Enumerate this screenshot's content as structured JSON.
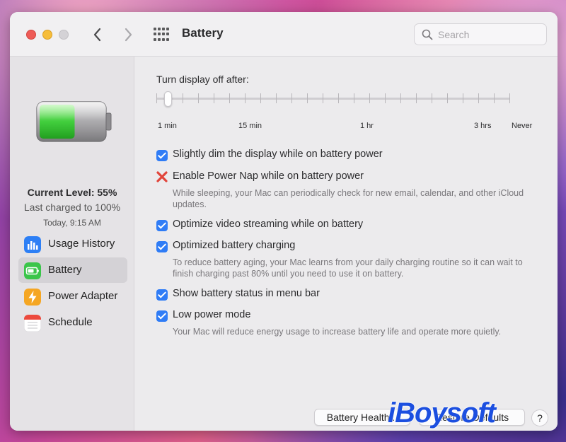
{
  "window": {
    "title": "Battery",
    "search_placeholder": "Search"
  },
  "sidebar": {
    "current_level": "Current Level: 55%",
    "battery_level": 0.55,
    "last_charged": "Last charged to 100%",
    "charged_time": "Today, 9:15 AM",
    "items": [
      {
        "label": "Usage History",
        "icon": "usage-history-icon",
        "active": false
      },
      {
        "label": "Battery",
        "icon": "battery-icon",
        "active": true
      },
      {
        "label": "Power Adapter",
        "icon": "power-adapter-icon",
        "active": false
      },
      {
        "label": "Schedule",
        "icon": "schedule-icon",
        "active": false
      }
    ]
  },
  "slider": {
    "label": "Turn display off after:",
    "ticks": [
      "1 min",
      "15 min",
      "1 hr",
      "3 hrs",
      "Never"
    ],
    "value": "1 min"
  },
  "options": [
    {
      "label": "Slightly dim the display while on battery power",
      "checked": true
    },
    {
      "label": "Enable Power Nap while on battery power",
      "checked": false,
      "desc": "While sleeping, your Mac can periodically check for new email, calendar, and other iCloud updates."
    },
    {
      "label": "Optimize video streaming while on battery",
      "checked": true
    },
    {
      "label": "Optimized battery charging",
      "checked": true,
      "desc": "To reduce battery aging, your Mac learns from your daily charging routine so it can wait to finish charging past 80% until you need to use it on battery."
    },
    {
      "label": "Show battery status in menu bar",
      "checked": true
    },
    {
      "label": "Low power mode",
      "checked": true,
      "desc": "Your Mac will reduce energy usage to increase battery life and operate more quietly."
    }
  ],
  "buttons": {
    "battery_health": "Battery Health...",
    "restore_defaults": "Restore Defaults",
    "help": "?"
  },
  "watermark": "iBoysoft",
  "colors": {
    "accent": "#2f7cf6",
    "battery_green": "#3fd03a",
    "unchecked_mark": "#e1443a"
  }
}
